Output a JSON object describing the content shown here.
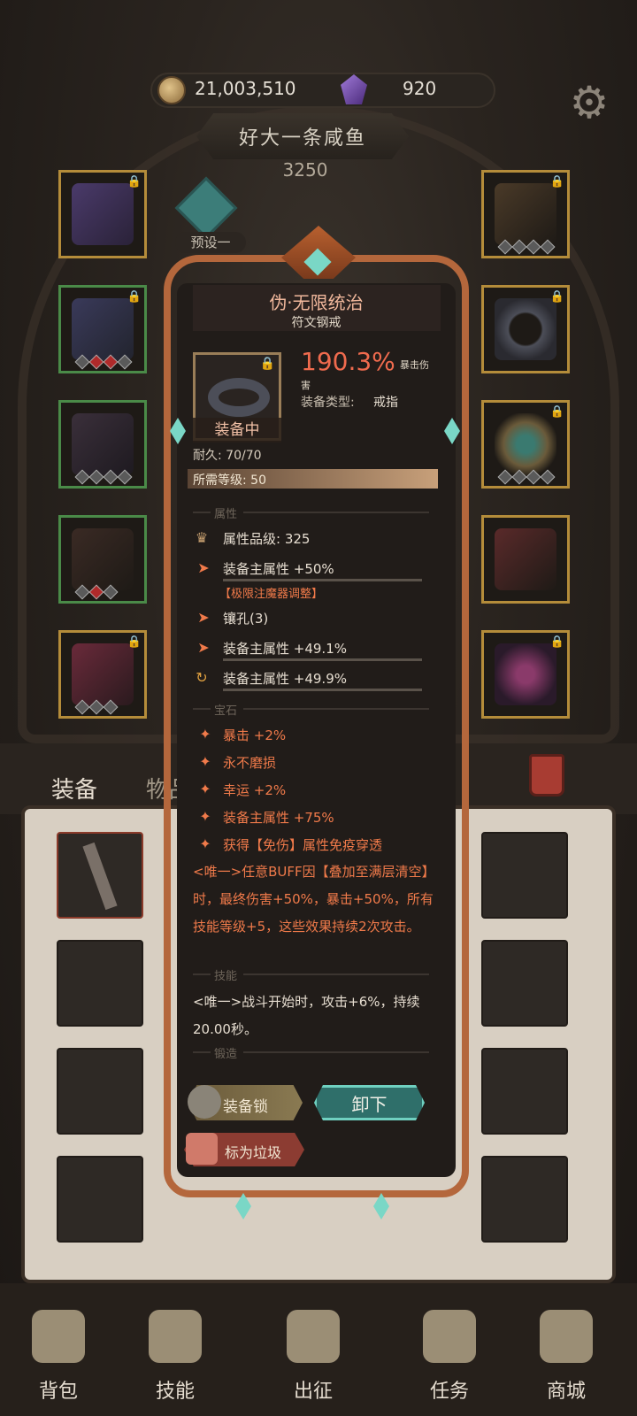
{
  "header": {
    "gold": "21,003,510",
    "gems": "920",
    "player_name": "好大一条咸鱼",
    "power": "3250",
    "preset": "预设一"
  },
  "tabs": {
    "equipment": "装备",
    "items": "物品"
  },
  "tooltip": {
    "name": "伪·无限统治",
    "subtitle": "符文钢戒",
    "equipped_label": "装备中",
    "main_stat_value": "190.3%",
    "main_stat_label_1": "暴击伤",
    "main_stat_label_2": "害",
    "type_label": "装备类型:",
    "type_value": "戒指",
    "durability": "耐久: 70/70",
    "required_level": "所需等级: 50",
    "section_attributes": "属性",
    "attribute_grade": "属性品级: 325",
    "attr_1": "装备主属性 +50%",
    "attr_1_note": "【极限注魔器调整】",
    "sockets": "镶孔(3)",
    "attr_2": "装备主属性 +49.1%",
    "attr_3": "装备主属性 +49.9%",
    "section_gems": "宝石",
    "gem_1": "暴击 +2%",
    "gem_2": "永不磨损",
    "gem_3": "幸运 +2%",
    "gem_4": "装备主属性 +75%",
    "gem_5": "获得【免伤】属性免疫穿透",
    "unique_desc": "<唯一>任意BUFF因【叠加至满层清空】时，最终伤害+50%，暴击+50%，所有技能等级+5，这些效果持续2次攻击。",
    "section_skills": "技能",
    "skill_desc": "<唯一>战斗开始时，攻击+6%，持续20.00秒。",
    "section_forge": "锻造",
    "btn_lock": "装备锁",
    "btn_unequip": "卸下",
    "btn_junk": "标为垃圾"
  },
  "nav": [
    {
      "label": "背包"
    },
    {
      "label": "技能"
    },
    {
      "label": "出征"
    },
    {
      "label": "任务"
    },
    {
      "label": "商城"
    }
  ],
  "colors": {
    "accent_orange": "#f06b4e",
    "teal": "#6fd0c0",
    "frame_copper": "#b4673c"
  }
}
